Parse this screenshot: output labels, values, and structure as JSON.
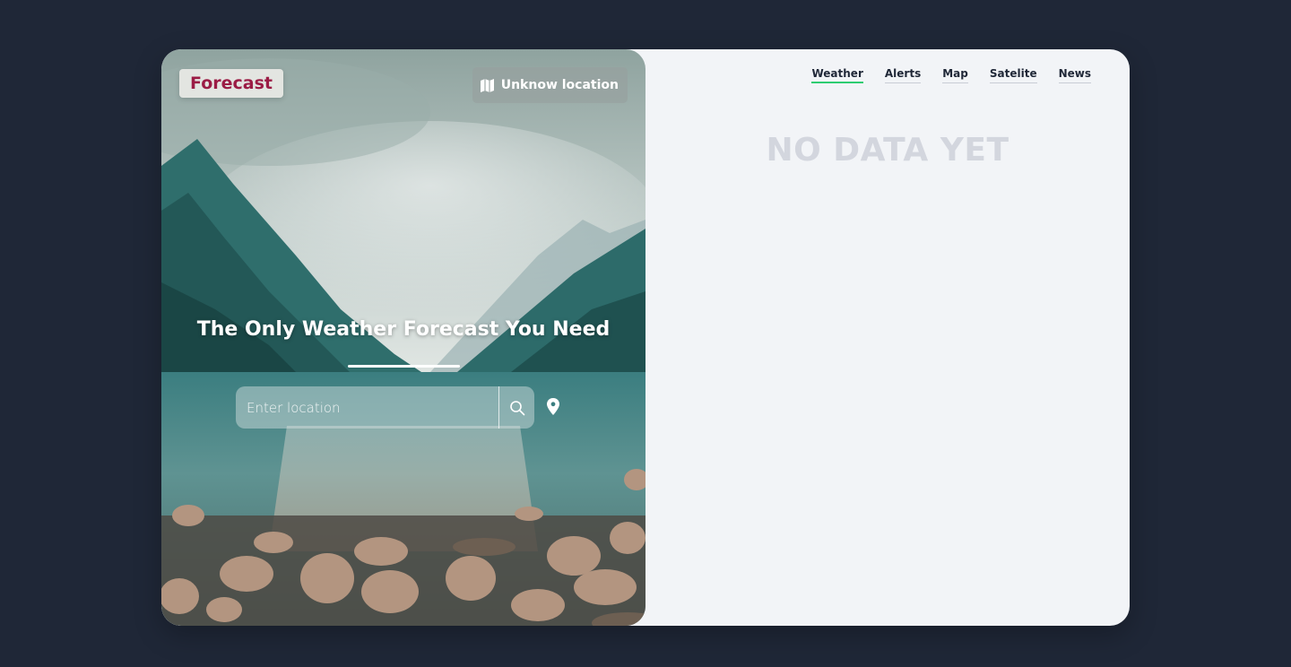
{
  "brand": {
    "name": "Forecast",
    "color": "#9b1c45"
  },
  "location_button": {
    "label": "Unknow location",
    "icon": "map-icon"
  },
  "hero": {
    "title": "The Only Weather Forecast You Need"
  },
  "search": {
    "placeholder": "Enter location",
    "value": "",
    "button_icon": "search-icon",
    "geolocate_icon": "location-pin-icon"
  },
  "nav": {
    "items": [
      {
        "label": "Weather",
        "active": true
      },
      {
        "label": "Alerts",
        "active": false
      },
      {
        "label": "Map",
        "active": false
      },
      {
        "label": "Satelite",
        "active": false
      },
      {
        "label": "News",
        "active": false
      }
    ],
    "active_color": "#2ecc71"
  },
  "main": {
    "empty_message": "NO DATA YET"
  },
  "colors": {
    "page_background": "#1f2737",
    "panel_background": "#f2f4f7"
  }
}
